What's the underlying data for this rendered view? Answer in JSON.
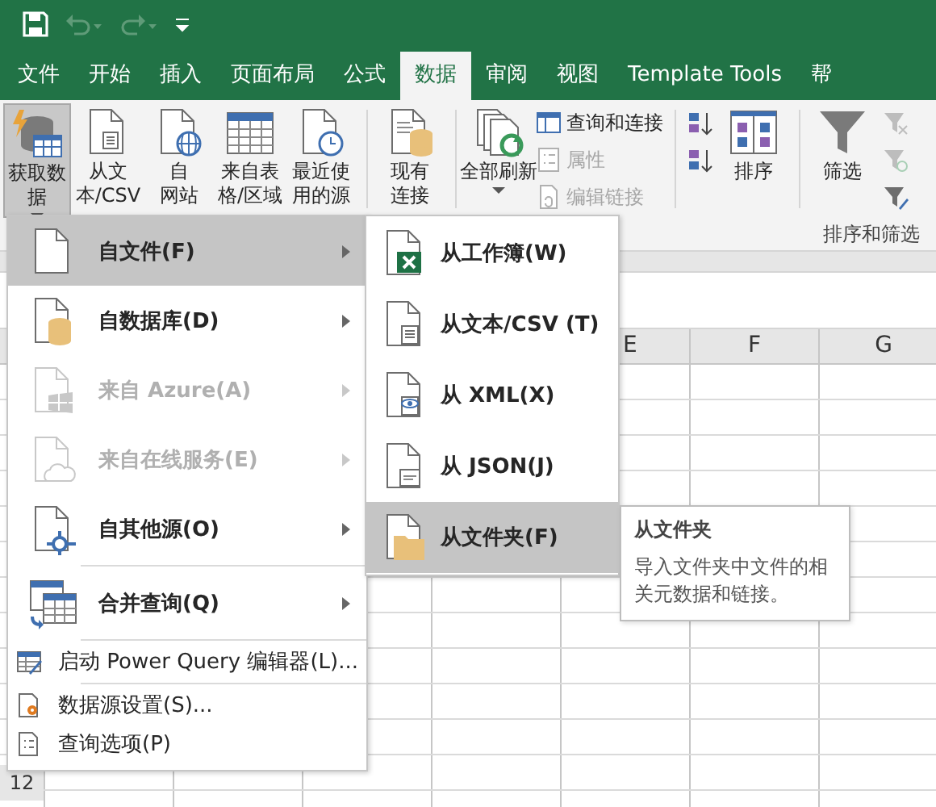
{
  "quick_access": [
    {
      "kind": "save",
      "disabled": false
    },
    {
      "kind": "undo",
      "disabled": true
    },
    {
      "kind": "redo",
      "disabled": true
    },
    {
      "kind": "customize",
      "disabled": false
    }
  ],
  "tabs": [
    {
      "label": "文件",
      "selected": false
    },
    {
      "label": "开始",
      "selected": false
    },
    {
      "label": "插入",
      "selected": false
    },
    {
      "label": "页面布局",
      "selected": false
    },
    {
      "label": "公式",
      "selected": false
    },
    {
      "label": "数据",
      "selected": true
    },
    {
      "label": "审阅",
      "selected": false
    },
    {
      "label": "视图",
      "selected": false
    },
    {
      "label": "Template Tools",
      "selected": false
    },
    {
      "label": "帮",
      "selected": false
    }
  ],
  "ribbon": {
    "controls": [
      {
        "kind": "large",
        "lines": [
          "获取数",
          "据"
        ],
        "pressed": true,
        "dropdown": true,
        "disabled": false
      },
      {
        "kind": "large",
        "lines": [
          "从文",
          "本/CSV"
        ],
        "pressed": false,
        "disabled": false
      },
      {
        "kind": "large",
        "lines": [
          "自",
          "网站"
        ],
        "pressed": false,
        "disabled": false
      },
      {
        "kind": "large",
        "lines": [
          "来自表",
          "格/区域"
        ],
        "pressed": false,
        "disabled": false
      },
      {
        "kind": "large",
        "lines": [
          "最近使",
          "用的源"
        ],
        "pressed": false,
        "disabled": false
      },
      {
        "kind": "separator"
      },
      {
        "kind": "large",
        "lines": [
          "现有",
          "连接"
        ],
        "pressed": false,
        "disabled": false
      },
      {
        "kind": "separator"
      },
      {
        "kind": "large",
        "lines": [
          "全部刷新"
        ],
        "pressed": false,
        "dropdown": true,
        "disabled": false
      },
      {
        "kind": "stack",
        "items": [
          {
            "label": "查询和连接",
            "disabled": false
          },
          {
            "label": "属性",
            "disabled": true
          },
          {
            "label": "编辑链接",
            "disabled": true
          }
        ]
      },
      {
        "kind": "separator"
      },
      {
        "kind": "stack",
        "items": [
          {
            "disabled": false
          },
          {
            "disabled": false
          }
        ]
      },
      {
        "kind": "large",
        "lines": [
          "排序"
        ],
        "pressed": false,
        "disabled": false
      },
      {
        "kind": "separator"
      },
      {
        "kind": "large",
        "lines": [
          "筛选"
        ],
        "pressed": false,
        "disabled": false
      },
      {
        "kind": "stack",
        "items": [
          {
            "disabled": true
          },
          {
            "disabled": true
          },
          {
            "disabled": false
          }
        ]
      }
    ],
    "group_label": "排序和筛选"
  },
  "sheet": {
    "columns": [
      "E",
      "F",
      "G"
    ],
    "rows": [
      "12"
    ]
  },
  "menu": {
    "items": [
      {
        "kind": "large",
        "label": "自文件(F)",
        "submenu": true,
        "disabled": false,
        "selected": true
      },
      {
        "kind": "large",
        "label": "自数据库(D)",
        "submenu": true,
        "disabled": false,
        "selected": false
      },
      {
        "kind": "large",
        "label": "来自 Azure(A)",
        "submenu": true,
        "disabled": true,
        "selected": false
      },
      {
        "kind": "large",
        "label": "来自在线服务(E)",
        "submenu": true,
        "disabled": true,
        "selected": false
      },
      {
        "kind": "large",
        "label": "自其他源(O)",
        "submenu": true,
        "disabled": false,
        "selected": false
      },
      {
        "kind": "separator"
      },
      {
        "kind": "large",
        "label": "合并查询(Q)",
        "submenu": true,
        "disabled": false,
        "selected": false
      },
      {
        "kind": "separator"
      },
      {
        "kind": "small",
        "label": "启动 Power Query 编辑器(L)...",
        "submenu": false,
        "disabled": false,
        "selected": false
      },
      {
        "kind": "separator"
      },
      {
        "kind": "small",
        "label": "数据源设置(S)...",
        "submenu": false,
        "disabled": false,
        "selected": false
      },
      {
        "kind": "small",
        "label": "查询选项(P)",
        "submenu": false,
        "disabled": false,
        "selected": false
      }
    ]
  },
  "submenu": {
    "items": [
      {
        "label": "从工作簿(W)",
        "selected": false
      },
      {
        "label": "从文本/CSV (T)",
        "selected": false
      },
      {
        "label": "从 XML(X)",
        "selected": false
      },
      {
        "label": "从 JSON(J)",
        "selected": false
      },
      {
        "label": "从文件夹(F)",
        "selected": true
      }
    ]
  },
  "tooltip": {
    "title": "从文件夹",
    "text": "导入文件夹中文件的相关元数据和链接。"
  }
}
